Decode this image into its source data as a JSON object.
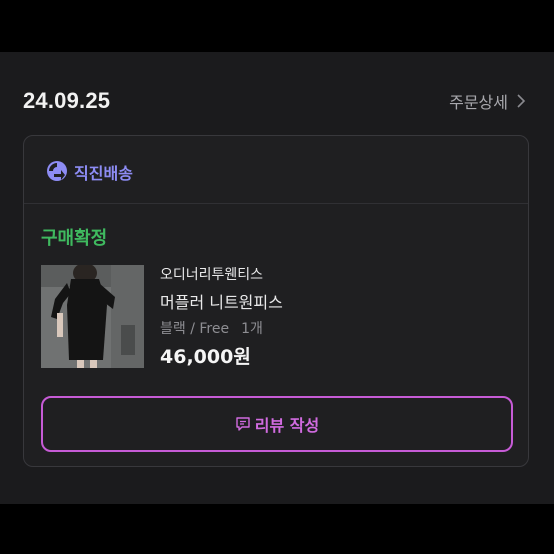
{
  "order": {
    "date": "24.09.25",
    "detail_link": "주문상세"
  },
  "shipping": {
    "label": "직진배송",
    "icon": "arrow-circle-icon",
    "color": "#8d8cf4"
  },
  "status": {
    "text": "구매확정",
    "color": "#3fb95f"
  },
  "product": {
    "brand": "오디너리투웬티스",
    "name": "머플러 니트원피스",
    "option": "블랙 / Free",
    "quantity": "1개",
    "price": "46,000원"
  },
  "review_button": {
    "label": "리뷰 작성",
    "icon": "chat-edit-icon",
    "color": "#c65bd6"
  }
}
